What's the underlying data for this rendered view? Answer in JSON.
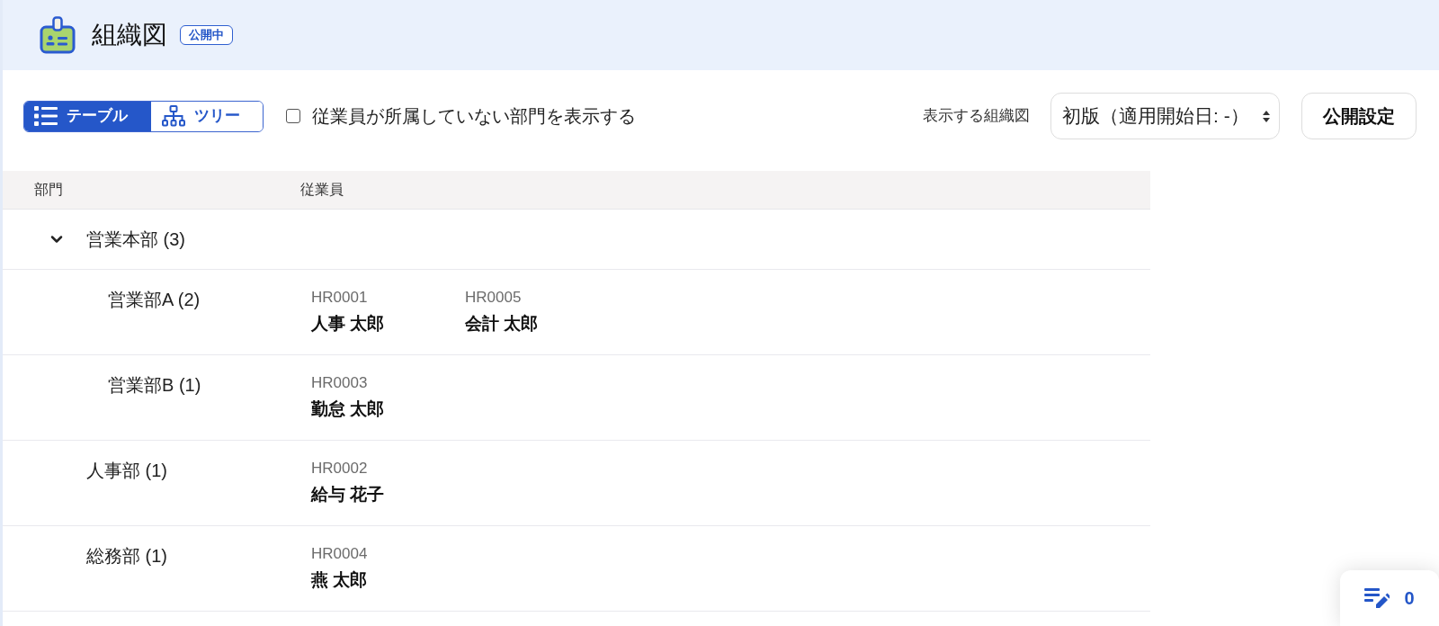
{
  "header": {
    "title": "組織図",
    "status_badge": "公開中"
  },
  "toolbar": {
    "view_tabs": [
      {
        "label": "テーブル",
        "kind": "table",
        "selected": true
      },
      {
        "label": "ツリー",
        "kind": "tree",
        "selected": false
      }
    ],
    "empty_departments_checkbox": {
      "label": "従業員が所属していない部門を表示する",
      "checked": false
    },
    "org_chart_select": {
      "label": "表示する組織図",
      "value": "初版（適用開始日: -）"
    },
    "publish_settings_button": "公開設定"
  },
  "table": {
    "columns": [
      "部門",
      "従業員"
    ],
    "rows": [
      {
        "department": "営業本部 (3)",
        "expanded": true,
        "children": [
          {
            "department": "営業部A (2)",
            "employees": [
              {
                "code": "HR0001",
                "name": "人事 太郎"
              },
              {
                "code": "HR0005",
                "name": "会計 太郎"
              }
            ]
          },
          {
            "department": "営業部B (1)",
            "employees": [
              {
                "code": "HR0003",
                "name": "勤怠 太郎"
              }
            ]
          }
        ]
      },
      {
        "department": "人事部 (1)",
        "employees": [
          {
            "code": "HR0002",
            "name": "給与 花子"
          }
        ]
      },
      {
        "department": "総務部 (1)",
        "employees": [
          {
            "code": "HR0004",
            "name": "燕 太郎"
          }
        ]
      }
    ]
  },
  "floating_button": {
    "count": "0"
  }
}
